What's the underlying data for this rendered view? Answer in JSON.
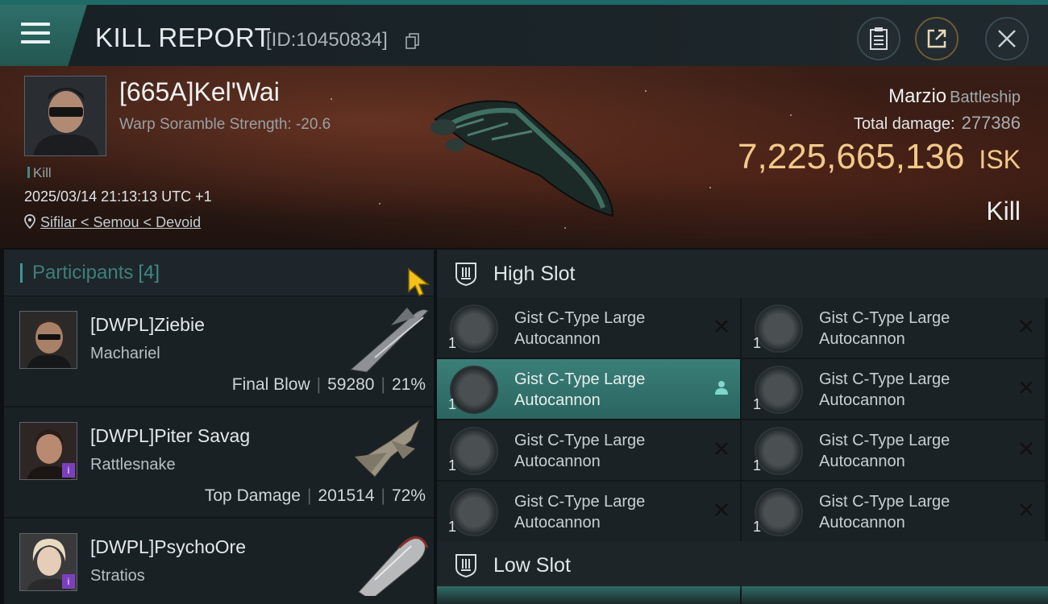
{
  "header": {
    "title": "KILL REPORT",
    "report_id": "[ID:10450834]"
  },
  "victim": {
    "pilot": "[665A]Kel'Wai",
    "scramble": "Warp Soramble Strength: -20.6",
    "tag": "Kill",
    "datetime": "2025/03/14 21:13:13 UTC +1",
    "location": "Sifilar < Semou < Devoid",
    "ship_name": "Marzio",
    "ship_class": "Battleship",
    "damage_label": "Total damage:",
    "damage_value": "277386",
    "isk_value": "7,225,665,136",
    "isk_unit": "ISK",
    "result": "Kill"
  },
  "participants": {
    "label": "Participants",
    "count": "[4]",
    "items": [
      {
        "name": "[DWPL]Ziebie",
        "ship": "Machariel",
        "stat_label": "Final Blow",
        "damage": "59280",
        "percent": "21%"
      },
      {
        "name": "[DWPL]Piter Savag",
        "ship": "Rattlesnake",
        "stat_label": "Top Damage",
        "damage": "201514",
        "percent": "72%"
      },
      {
        "name": "[DWPL]PsychoOre",
        "ship": "Stratios",
        "stat_label": "",
        "damage": "",
        "percent": ""
      }
    ]
  },
  "fittings": {
    "high_slot_label": "High Slot",
    "low_slot_label": "Low Slot",
    "modules": [
      {
        "line1": "Gist C-Type Large",
        "line2": "Autocannon",
        "qty": "1"
      },
      {
        "line1": "Gist C-Type Large",
        "line2": "Autocannon",
        "qty": "1"
      },
      {
        "line1": "Gist C-Type Large",
        "line2": "Autocannon",
        "qty": "1"
      },
      {
        "line1": "Gist C-Type Large",
        "line2": "Autocannon",
        "qty": "1"
      },
      {
        "line1": "Gist C-Type Large",
        "line2": "Autocannon",
        "qty": "1"
      },
      {
        "line1": "Gist C-Type Large",
        "line2": "Autocannon",
        "qty": "1"
      },
      {
        "line1": "Gist C-Type Large",
        "line2": "Autocannon",
        "qty": "1"
      },
      {
        "line1": "Gist C-Type Large",
        "line2": "Autocannon",
        "qty": "1"
      }
    ]
  },
  "icons": {
    "menu": "menu-icon",
    "copy": "copy-icon",
    "clipboard": "clipboard-icon",
    "share": "share-icon",
    "close": "close-icon",
    "location": "location-pin-icon",
    "slot": "shield-icon",
    "destroyed": "x-icon",
    "dropped": "person-icon"
  },
  "colors": {
    "accent": "#3a9a92",
    "isk": "#f1c98a",
    "active_module": "#3a7f78"
  }
}
